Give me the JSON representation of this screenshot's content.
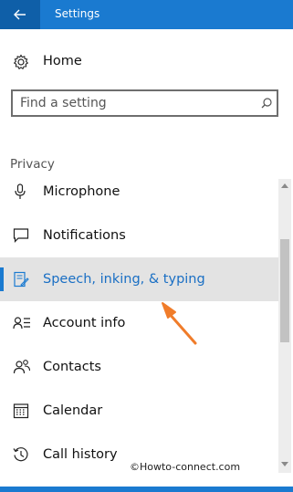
{
  "window": {
    "title": "Settings",
    "accent_color": "#1a7ad0"
  },
  "home": {
    "label": "Home",
    "icon": "gear-icon"
  },
  "search": {
    "placeholder": "Find a setting",
    "icon": "search-icon"
  },
  "section": {
    "header": "Privacy"
  },
  "nav_items": [
    {
      "label": "Microphone",
      "icon": "microphone-icon"
    },
    {
      "label": "Notifications",
      "icon": "notification-icon"
    },
    {
      "label": "Speech, inking, & typing",
      "icon": "speech-pen-icon",
      "selected": true
    },
    {
      "label": "Account info",
      "icon": "account-info-icon"
    },
    {
      "label": "Contacts",
      "icon": "contacts-icon"
    },
    {
      "label": "Calendar",
      "icon": "calendar-icon"
    },
    {
      "label": "Call history",
      "icon": "history-icon"
    }
  ],
  "annotation": {
    "arrow_color": "#f07c2a"
  },
  "watermark": "©Howto-connect.com"
}
